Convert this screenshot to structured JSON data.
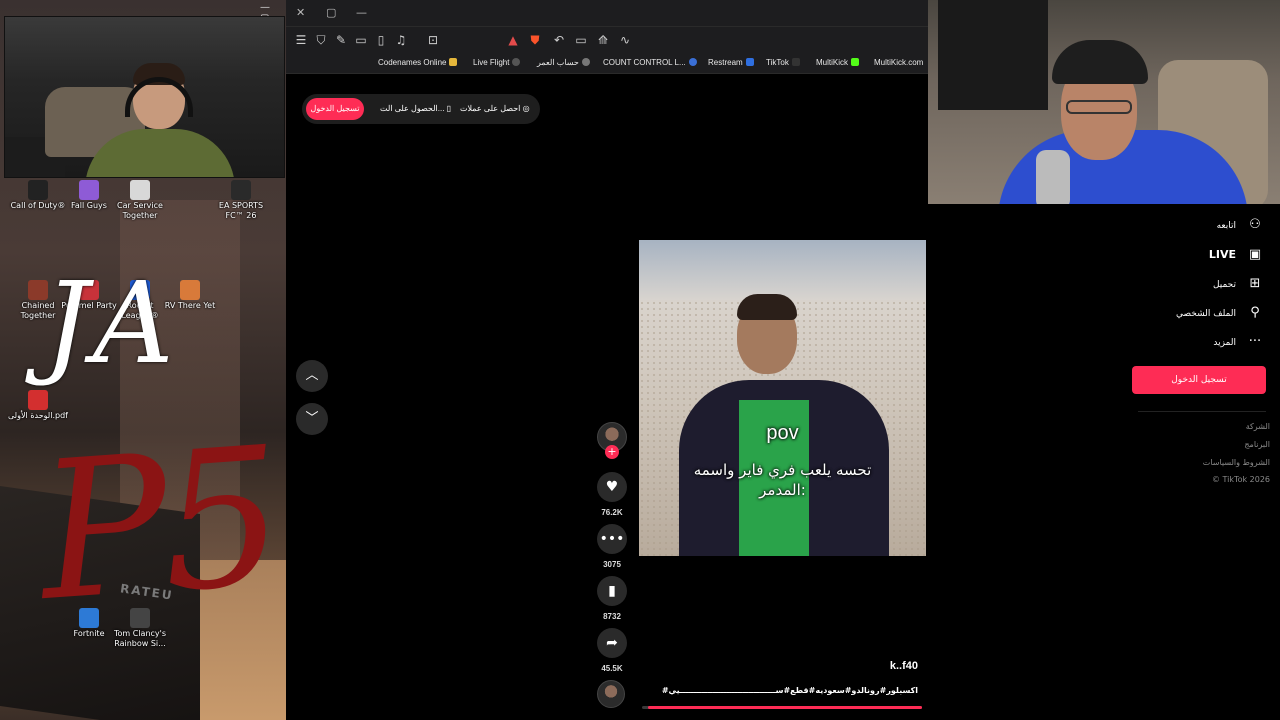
{
  "desktop": {
    "icons": [
      {
        "label": "Call of Duty®",
        "color": "#222"
      },
      {
        "label": "Fall Guys",
        "color": "#8e5bd6"
      },
      {
        "label": "Car Service Together",
        "color": "#d8d8d8"
      },
      {
        "label": "EA SPORTS FC™ 26",
        "color": "#2a2a2a"
      },
      {
        "label": "Chained Together",
        "color": "#8b3a2a"
      },
      {
        "label": "Pummel Party",
        "color": "#c8323a"
      },
      {
        "label": "Rocket League®",
        "color": "#1e5bd6"
      },
      {
        "label": "RV There Yet",
        "color": "#d87a3a"
      },
      {
        "label": "الوحدة الأولى.pdf",
        "color": "#d32f2f"
      },
      {
        "label": "Fortnite",
        "color": "#2d7ad6"
      },
      {
        "label": "Tom Clancy's Rainbow Si...",
        "color": "#444"
      }
    ],
    "overlay_ja": "JA",
    "overlay_p5": "P5",
    "crate_text": "RATEU"
  },
  "browser": {
    "titlebar": {
      "close": "✕",
      "restore": "▢",
      "minimize": "—"
    },
    "toolbar_icons": [
      "menu-icon",
      "shield-icon",
      "extension-icon",
      "sidebar-icon",
      "sidebar-icon",
      "music-icon",
      "screenshot-icon",
      "brave-icon",
      "shields-icon",
      "undo-icon",
      "cast-icon",
      "translate-icon",
      "stats-icon"
    ],
    "bookmarks": [
      {
        "label": "Codenames Online",
        "color": "#e5b73b"
      },
      {
        "label": "Live Flight",
        "color": "#555"
      },
      {
        "label": "حساب العمر",
        "color": "#555"
      },
      {
        "label": "COUNT CONTROL L...",
        "color": "#3a6fd6"
      },
      {
        "label": "Restream",
        "color": "#2f6fe0"
      },
      {
        "label": "TikTok",
        "color": "#111"
      },
      {
        "label": "MultiKick",
        "color": "#53fc18"
      },
      {
        "label": "MultiKick.com",
        "color": "#555"
      }
    ]
  },
  "tiktok": {
    "top_pill": {
      "login": "تسجيل الدخول",
      "get_app": "الحصول على الت...",
      "get_coins": "احصل على عملات"
    },
    "video": {
      "caption_pov": "pov",
      "caption_ar": "تحسه يلعب فري فاير واسمه المدمر:"
    },
    "actions": {
      "likes": "76.2K",
      "comments": "3075",
      "saves": "8732",
      "shares": "45.5K"
    },
    "author": "k..f40",
    "description": "#اكسبلور#رونالدو#سعوديه#قطع#ســـــــــــــــــــــــــــــــــــيي",
    "progress": 0.98
  },
  "side": {
    "items": [
      {
        "label": "اتابعه",
        "icon": "follow-user-icon",
        "glyph": "👤"
      },
      {
        "label": "LIVE",
        "icon": "live-tv-icon",
        "glyph": "📺"
      },
      {
        "label": "تحميل",
        "icon": "upload-icon",
        "glyph": "⊞"
      },
      {
        "label": "الملف الشخصي",
        "icon": "profile-icon",
        "glyph": "👤"
      },
      {
        "label": "المزيد",
        "icon": "more-icon",
        "glyph": "···"
      }
    ],
    "login_button": "تسجيل الدخول",
    "footer": [
      "الشركة",
      "البرنامج",
      "الشروط والسياسات",
      "© TikTok 2026"
    ]
  },
  "colors": {
    "tiktok_red": "#fe2c55",
    "browser_bg": "#1d1d1f"
  }
}
